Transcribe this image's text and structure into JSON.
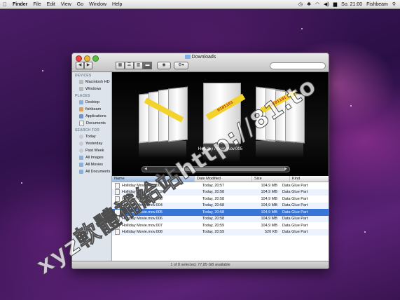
{
  "menubar": {
    "apple": "",
    "app": "Finder",
    "items": [
      "File",
      "Edit",
      "View",
      "Go",
      "Window",
      "Help"
    ],
    "clock": "So. 21:00",
    "user": "Fishbeam"
  },
  "window": {
    "title": "Downloads"
  },
  "toolbar": {
    "back": "◀",
    "forward": "▶"
  },
  "sidebar": {
    "devices_label": "DEVICES",
    "devices": [
      "Macintosh HD",
      "Windows"
    ],
    "places_label": "PLACES",
    "places": [
      "Desktop",
      "fishbeam",
      "Applications",
      "Documents"
    ],
    "search_label": "SEARCH FOR",
    "searches": [
      "Today",
      "Yesterday",
      "Past Week",
      "All Images",
      "All Movies",
      "All Documents"
    ]
  },
  "coverflow": {
    "selected_title": "Holliday Movie.mov.005",
    "tape_text": "0101101"
  },
  "list": {
    "columns": [
      "Name",
      "Date Modified",
      "Size",
      "Kind"
    ],
    "rows": [
      {
        "name": "Holliday Movie.mov.001",
        "date": "Today, 20:57",
        "size": "104,9 MB",
        "kind": "Data Glue Part"
      },
      {
        "name": "Holliday Movie.mov.002",
        "date": "Today, 20:58",
        "size": "104,9 MB",
        "kind": "Data Glue Part"
      },
      {
        "name": "Holliday Movie.mov.003",
        "date": "Today, 20:58",
        "size": "104,9 MB",
        "kind": "Data Glue Part"
      },
      {
        "name": "Holliday Movie.mov.004",
        "date": "Today, 20:58",
        "size": "104,9 MB",
        "kind": "Data Glue Part"
      },
      {
        "name": "Holliday Movie.mov.005",
        "date": "Today, 20:58",
        "size": "104,9 MB",
        "kind": "Data Glue Part"
      },
      {
        "name": "Holliday Movie.mov.006",
        "date": "Today, 20:58",
        "size": "104,9 MB",
        "kind": "Data Glue Part"
      },
      {
        "name": "Holliday Movie.mov.007",
        "date": "Today, 20:59",
        "size": "104,9 MB",
        "kind": "Data Glue Part"
      },
      {
        "name": "Holliday Movie.mov.008",
        "date": "Today, 20:59",
        "size": "520 KB",
        "kind": "Data Glue Part"
      }
    ],
    "selected_index": 4
  },
  "status": "1 of 8 selected, 77,85 GB available",
  "watermark": "xyz軟體補給站http://81.to",
  "colors": {
    "selection": "#3875d7",
    "tape": "#f2d22b",
    "desktop": "#4b1d66"
  }
}
